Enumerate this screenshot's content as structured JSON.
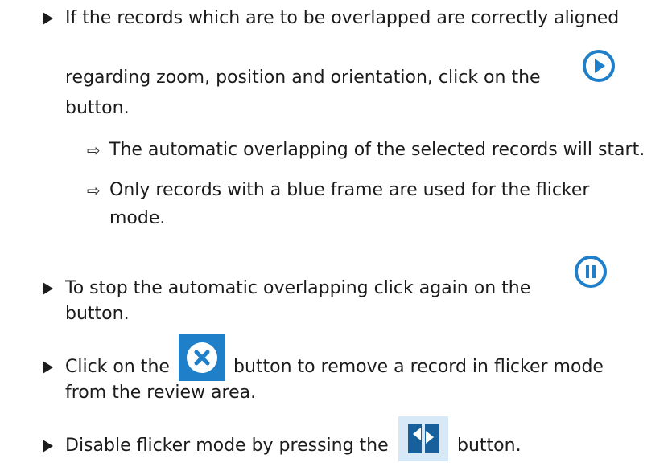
{
  "steps": [
    {
      "lines": [
        "If the records which are to be overlapped are correctly aligned",
        "regarding zoom, position and orientation, click on the",
        "button."
      ],
      "icon": "play-circle-icon",
      "results": [
        "The automatic overlapping of the selected records will start.",
        "Only records with a blue frame are used for the flicker",
        "mode."
      ]
    },
    {
      "lines": [
        "To stop the automatic overlapping click again on the",
        "button."
      ],
      "icon": "pause-circle-icon"
    },
    {
      "lines_parts": [
        "Click on the",
        "button to remove a record in flicker mode"
      ],
      "line2": "from the review area.",
      "icon": "remove-x-icon"
    },
    {
      "lines_parts": [
        "Disable flicker mode by pressing the",
        "button."
      ],
      "icon": "flicker-toggle-icon"
    }
  ],
  "colors": {
    "icon_blue": "#1f7fc9",
    "text": "#1b1b1b"
  }
}
